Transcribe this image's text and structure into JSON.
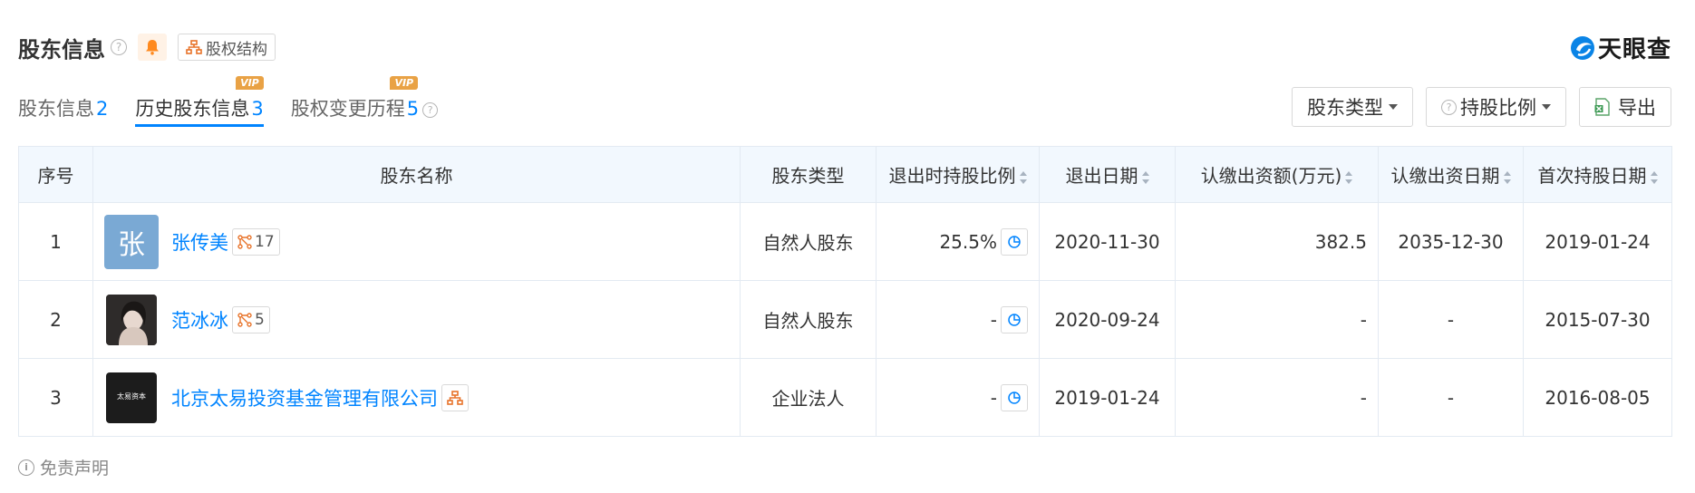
{
  "header": {
    "title": "股东信息",
    "structure_label": "股权结构",
    "logo_text": "天眼查"
  },
  "tabs": [
    {
      "label": "股东信息",
      "count": "2",
      "vip": ""
    },
    {
      "label": "历史股东信息",
      "count": "3",
      "vip": "VIP"
    },
    {
      "label": "股权变更历程",
      "count": "5",
      "vip": "VIP"
    }
  ],
  "toolbar": {
    "type_filter": "股东类型",
    "ratio_filter": "持股比例",
    "export": "导出"
  },
  "table": {
    "headers": [
      "序号",
      "股东名称",
      "股东类型",
      "退出时持股比例",
      "退出日期",
      "认缴出资额(万元)",
      "认缴出资日期",
      "首次持股日期"
    ],
    "rows": [
      {
        "index": "1",
        "avatar_char": "张",
        "name": "张传美",
        "relation_count": "17",
        "type": "自然人股东",
        "exit_ratio": "25.5%",
        "exit_date": "2020-11-30",
        "amount": "382.5",
        "subscribe_date": "2035-12-30",
        "first_date": "2019-01-24"
      },
      {
        "index": "2",
        "avatar_char": "",
        "name": "范冰冰",
        "relation_count": "5",
        "type": "自然人股东",
        "exit_ratio": "-",
        "exit_date": "2020-09-24",
        "amount": "-",
        "subscribe_date": "-",
        "first_date": "2015-07-30"
      },
      {
        "index": "3",
        "avatar_char": "",
        "company_logo_text": "太易资本",
        "name": "北京太易投资基金管理有限公司",
        "relation_count": "",
        "type": "企业法人",
        "exit_ratio": "-",
        "exit_date": "2019-01-24",
        "amount": "-",
        "subscribe_date": "-",
        "first_date": "2016-08-05"
      }
    ]
  },
  "footer": {
    "disclaimer": "免责声明"
  },
  "colors": {
    "accent": "#0084ff",
    "vip": "#e9a245",
    "header_bg": "#f2f8fe",
    "bell": "#ff8a1f",
    "structure_icon": "#e8732a"
  }
}
